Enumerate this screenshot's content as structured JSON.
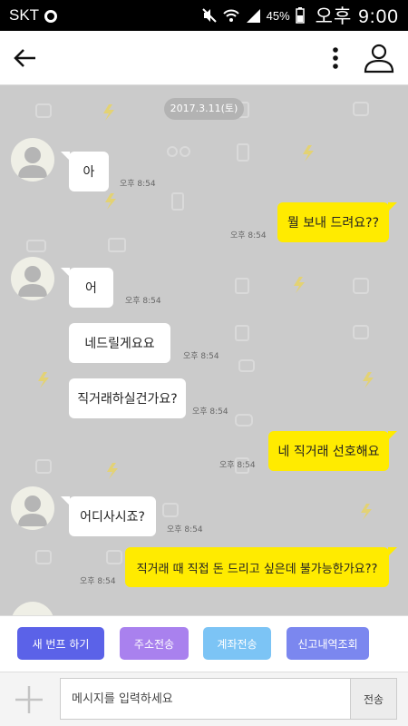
{
  "status_bar": {
    "carrier": "SKT",
    "battery": "45%",
    "time": "오후 9:00"
  },
  "app_bar": {
    "back_icon": "arrow-left-icon",
    "more_icon": "more-vertical-icon",
    "profile_icon": "person-outline-icon"
  },
  "chat": {
    "date": "2017.3.11(토)",
    "messages": [
      {
        "from": "them",
        "text": "아",
        "time": "오후 8:54"
      },
      {
        "from": "me",
        "text": "뭘 보내 드려요??",
        "time": "오후 8:54"
      },
      {
        "from": "them",
        "text": "어",
        "time": "오후 8:54"
      },
      {
        "from": "them",
        "text": "네드릴게요요",
        "time": "오후 8:54"
      },
      {
        "from": "them",
        "text": "직거래하실건가요?",
        "time": "오후 8:54"
      },
      {
        "from": "me",
        "text": "네 직거래 선호해요",
        "time": "오후 8:54"
      },
      {
        "from": "them",
        "text": "어디사시죠?",
        "time": "오후 8:54"
      },
      {
        "from": "me",
        "text": "직거래 때 직접 돈 드리고 싶은데 불가능한가요??",
        "time": "오후 8:54"
      }
    ]
  },
  "quick_actions": [
    {
      "label": "새 번프 하기",
      "color": "#5b62e8"
    },
    {
      "label": "주소전송",
      "color": "#a981ee"
    },
    {
      "label": "계좌전송",
      "color": "#7cc4f5"
    },
    {
      "label": "신고내역조회",
      "color": "#7b87ef"
    }
  ],
  "input": {
    "placeholder": "메시지를 입력하세요",
    "send_label": "전송",
    "plus_icon": "plus-icon"
  },
  "colors": {
    "chat_bg": "#cbcbcb",
    "my_bubble": "#ffeb00",
    "their_bubble": "#ffffff"
  }
}
